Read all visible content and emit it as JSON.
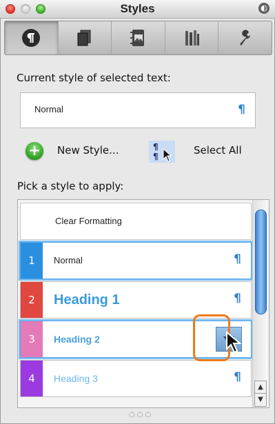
{
  "window": {
    "title": "Styles"
  },
  "toolbar": {
    "tabs": [
      {
        "icon": "paragraph-styles-icon",
        "active": true
      },
      {
        "icon": "document-pages-icon",
        "active": false
      },
      {
        "icon": "media-browser-icon",
        "active": false
      },
      {
        "icon": "reference-tools-icon",
        "active": false
      },
      {
        "icon": "wrench-icon",
        "active": false
      }
    ]
  },
  "current": {
    "label": "Current style of selected text:",
    "value": "Normal"
  },
  "actions": {
    "new_style": "New Style...",
    "select_all": "Select All"
  },
  "pick": {
    "label": "Pick a style to apply:",
    "clear": "Clear Formatting",
    "styles": [
      {
        "num": "1",
        "name": "Normal",
        "color": "#2b8fe0"
      },
      {
        "num": "2",
        "name": "Heading 1",
        "color": "#e0473f"
      },
      {
        "num": "3",
        "name": "Heading 2",
        "color": "#e57ab8"
      },
      {
        "num": "4",
        "name": "Heading 3",
        "color": "#9a3ae0"
      }
    ]
  },
  "pilcrow": "¶",
  "colors": {
    "accent": "#2d7fd5",
    "heading1_text": "#3a9ad9",
    "heading2_text": "#4a9fe0",
    "heading3_text": "#6bb7ee",
    "callout": "#ef7a16"
  }
}
